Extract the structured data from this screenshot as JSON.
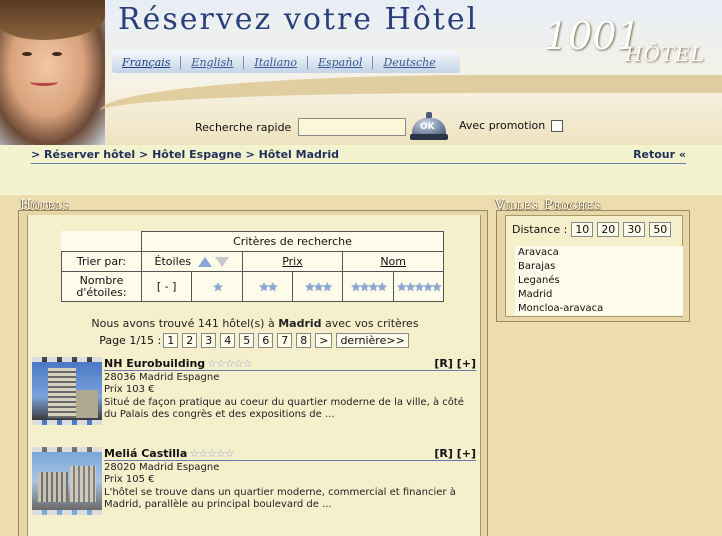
{
  "header": {
    "title": "Réservez votre Hôtel",
    "languages": [
      "Français",
      "English",
      "Italiano",
      "Español",
      "Deutsche"
    ],
    "logo_number": "1001",
    "logo_word": "HÔTEL"
  },
  "search": {
    "label": "Recherche rapide",
    "value": "",
    "ok_label": "OK",
    "promo_label": "Avec promotion"
  },
  "breadcrumb": {
    "items": [
      "> Réserver hôtel",
      "> Hôtel Espagne",
      "> Hôtel Madrid"
    ],
    "back": "Retour «"
  },
  "hotels_panel": {
    "title": "Hôtels",
    "criteria_header": "Critères de recherche",
    "sort_label": "Trier par:",
    "sort_etoiles": "Étoiles",
    "sort_prix": "Prix",
    "sort_nom": "Nom",
    "stars_label": "Nombre d'étoiles:",
    "stars_any": "[ - ]",
    "star_counts": [
      1,
      2,
      3,
      4,
      5
    ],
    "found_prefix": "Nous avons trouvé 141 hôtel(s) à",
    "found_city": "Madrid",
    "found_suffix": "avec vos critères",
    "page_label": "Page 1/15 :",
    "pages": [
      "1",
      "2",
      "3",
      "4",
      "5",
      "6",
      "7",
      "8"
    ],
    "next": ">",
    "last": "dernière>>"
  },
  "hotels": [
    {
      "name": "NH Eurobuilding",
      "stars": 5,
      "actions": "[R] [+]",
      "address": "28036 Madrid Espagne",
      "price": "Prix 103 €",
      "description": "Situé de façon pratique au coeur du quartier moderne de la ville, à côté du Palais des congrès et des expositions de ..."
    },
    {
      "name": "Meliá Castilla",
      "stars": 5,
      "actions": "[R] [+]",
      "address": "28020 Madrid Espagne",
      "price": "Prix 105 €",
      "description": "L'hôtel se trouve dans un quartier moderne, commercial et financier à Madrid, parallèle au principal boulevard de ..."
    }
  ],
  "villes_panel": {
    "title": "Villes Proches",
    "distance_label": "Distance :",
    "distances": [
      "10",
      "20",
      "30",
      "50"
    ],
    "cities": [
      "Aravaca",
      "Barajas",
      "Leganés",
      "Madrid",
      "Moncloa-aravaca"
    ]
  },
  "colors": {
    "accent_blue": "#2a3f7a",
    "panel_bg": "#f6efcc",
    "star_blue": "#8aa6d8"
  }
}
